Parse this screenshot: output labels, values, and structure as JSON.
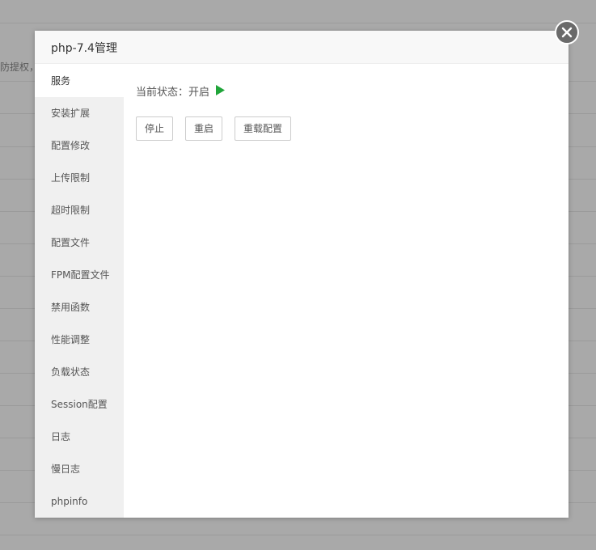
{
  "background": {
    "partial_text": "防提权，"
  },
  "dialog": {
    "title": "php-7.4管理",
    "close_icon": "close-icon"
  },
  "sidebar": {
    "items": [
      {
        "label": "服务",
        "active": true
      },
      {
        "label": "安装扩展"
      },
      {
        "label": "配置修改"
      },
      {
        "label": "上传限制"
      },
      {
        "label": "超时限制"
      },
      {
        "label": "配置文件"
      },
      {
        "label": "FPM配置文件"
      },
      {
        "label": "禁用函数"
      },
      {
        "label": "性能调整"
      },
      {
        "label": "负载状态"
      },
      {
        "label": "Session配置"
      },
      {
        "label": "日志"
      },
      {
        "label": "慢日志"
      },
      {
        "label": "phpinfo"
      }
    ]
  },
  "service": {
    "status_label": "当前状态：",
    "status_value": "开启",
    "status_icon": "play-icon",
    "status_color": "#20a53a",
    "buttons": {
      "stop": "停止",
      "restart": "重启",
      "reload": "重载配置"
    }
  }
}
